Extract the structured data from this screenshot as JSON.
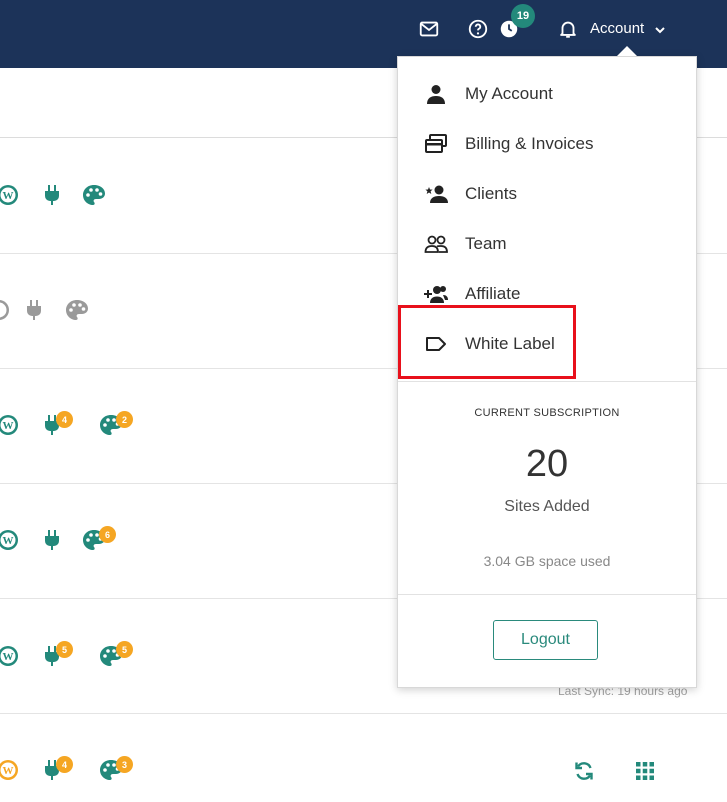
{
  "header": {
    "notifications_count": "19",
    "account_label": "Account"
  },
  "account_menu": {
    "items": [
      {
        "label": "My Account",
        "icon": "person-icon"
      },
      {
        "label": "Billing & Invoices",
        "icon": "billing-icon"
      },
      {
        "label": "Clients",
        "icon": "clients-icon"
      },
      {
        "label": "Team",
        "icon": "team-icon"
      },
      {
        "label": "Affiliate",
        "icon": "add-person-icon"
      },
      {
        "label": "White Label",
        "icon": "label-tag-icon"
      }
    ],
    "subscription_heading": "CURRENT SUBSCRIPTION",
    "sites_count": "20",
    "sites_caption": "Sites Added",
    "space_used": "3.04 GB space used",
    "logout_label": "Logout"
  },
  "site_rows": [
    {
      "plugin_updates": "",
      "theme_updates": "",
      "status": "active"
    },
    {
      "plugin_updates": "",
      "theme_updates": "",
      "status": "inactive"
    },
    {
      "plugin_updates": "4",
      "theme_updates": "2",
      "status": "active"
    },
    {
      "plugin_updates": "",
      "theme_updates": "6",
      "status": "active"
    },
    {
      "plugin_updates": "5",
      "theme_updates": "5",
      "status": "active"
    },
    {
      "plugin_updates": "4",
      "theme_updates": "3",
      "status": "warning"
    }
  ],
  "last_sync_text": "Last Sync: 19 hours ago",
  "colors": {
    "topbar": "#1c3359",
    "accent": "#23897b",
    "badge": "#f5a623",
    "highlight": "#e8101b"
  }
}
